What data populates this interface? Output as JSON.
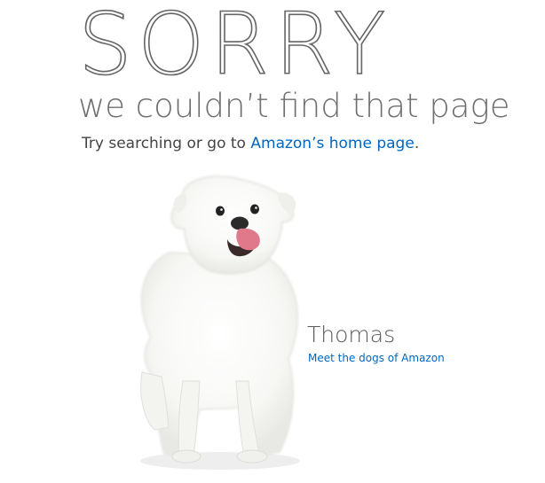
{
  "headline": "SORRY",
  "subhead": "we couldn’t find that page",
  "try_prefix": "Try searching or go to ",
  "home_link": "Amazon’s home page",
  "try_suffix": ".",
  "dog": {
    "name": "Thomas",
    "link": "Meet the dogs of Amazon",
    "image_icon": "white-dog-illustration"
  },
  "colors": {
    "link": "#0066c0",
    "text": "#555555"
  }
}
